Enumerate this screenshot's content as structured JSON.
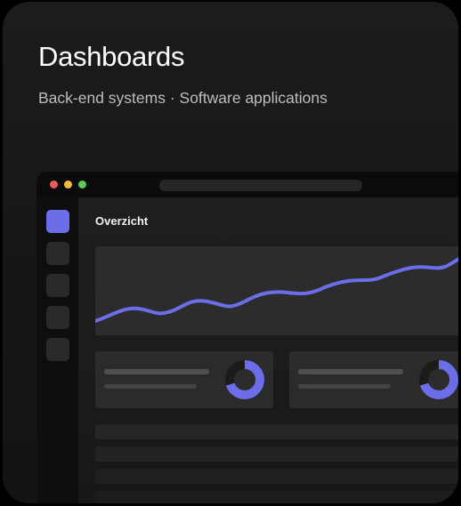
{
  "card": {
    "title": "Dashboards",
    "subtitle": "Back-end systems · Software applications"
  },
  "app_window": {
    "traffic_lights": [
      "red",
      "yellow",
      "green"
    ],
    "heading": "Overzicht",
    "sidebar_items": [
      "active-item",
      "item-2",
      "item-3",
      "item-4",
      "item-5"
    ],
    "stat_cards": [
      {
        "donut_fill": 0.7
      },
      {
        "donut_fill": 0.7
      }
    ],
    "list_rows": 4
  },
  "colors": {
    "accent": "#6b6ee8",
    "card_background": "#1a1a1a",
    "panel": "#2c2c2c",
    "dot_red": "#ec5c5c",
    "dot_yellow": "#f0be3a",
    "dot_green": "#5fcb57"
  }
}
